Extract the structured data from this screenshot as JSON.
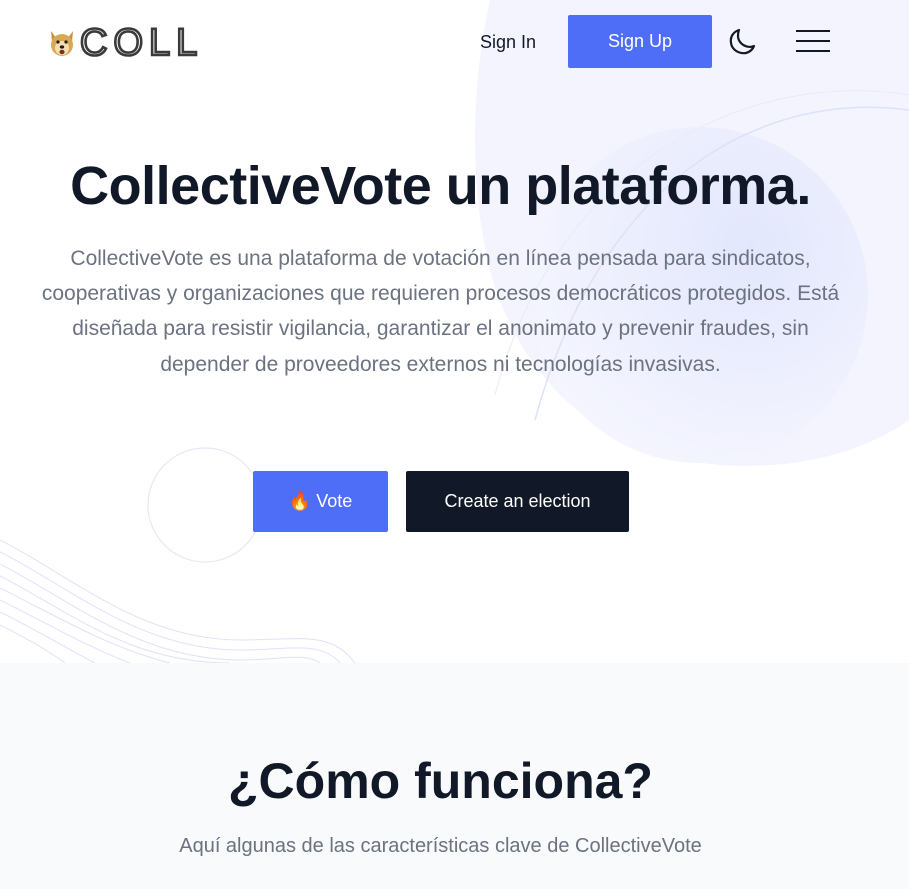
{
  "header": {
    "logo_text": "COLL",
    "sign_in_label": "Sign In",
    "sign_up_label": "Sign Up",
    "theme_toggle_icon": "moon-icon",
    "menu_icon": "hamburger-menu-icon"
  },
  "hero": {
    "title": "CollectiveVote un plataforma.",
    "description": "CollectiveVote es una plataforma de votación en línea pensada para sindicatos, cooperativas y organizaciones que requieren procesos democráticos protegidos. Está diseñada para resistir vigilancia, garantizar el anonimato y prevenir fraudes, sin depender de proveedores externos ni tecnologías invasivas.",
    "vote_button": {
      "icon": "🔥",
      "label": "Vote"
    },
    "create_button_label": "Create an election"
  },
  "features": {
    "title": "¿Cómo funciona?",
    "subtitle": "Aquí algunas de las características clave de CollectiveVote"
  },
  "colors": {
    "primary": "#4f6ef7",
    "dark": "#111827",
    "muted_text": "#6b7280",
    "section_bg": "#f9fafb",
    "deco_blob": "#eef0fe"
  }
}
